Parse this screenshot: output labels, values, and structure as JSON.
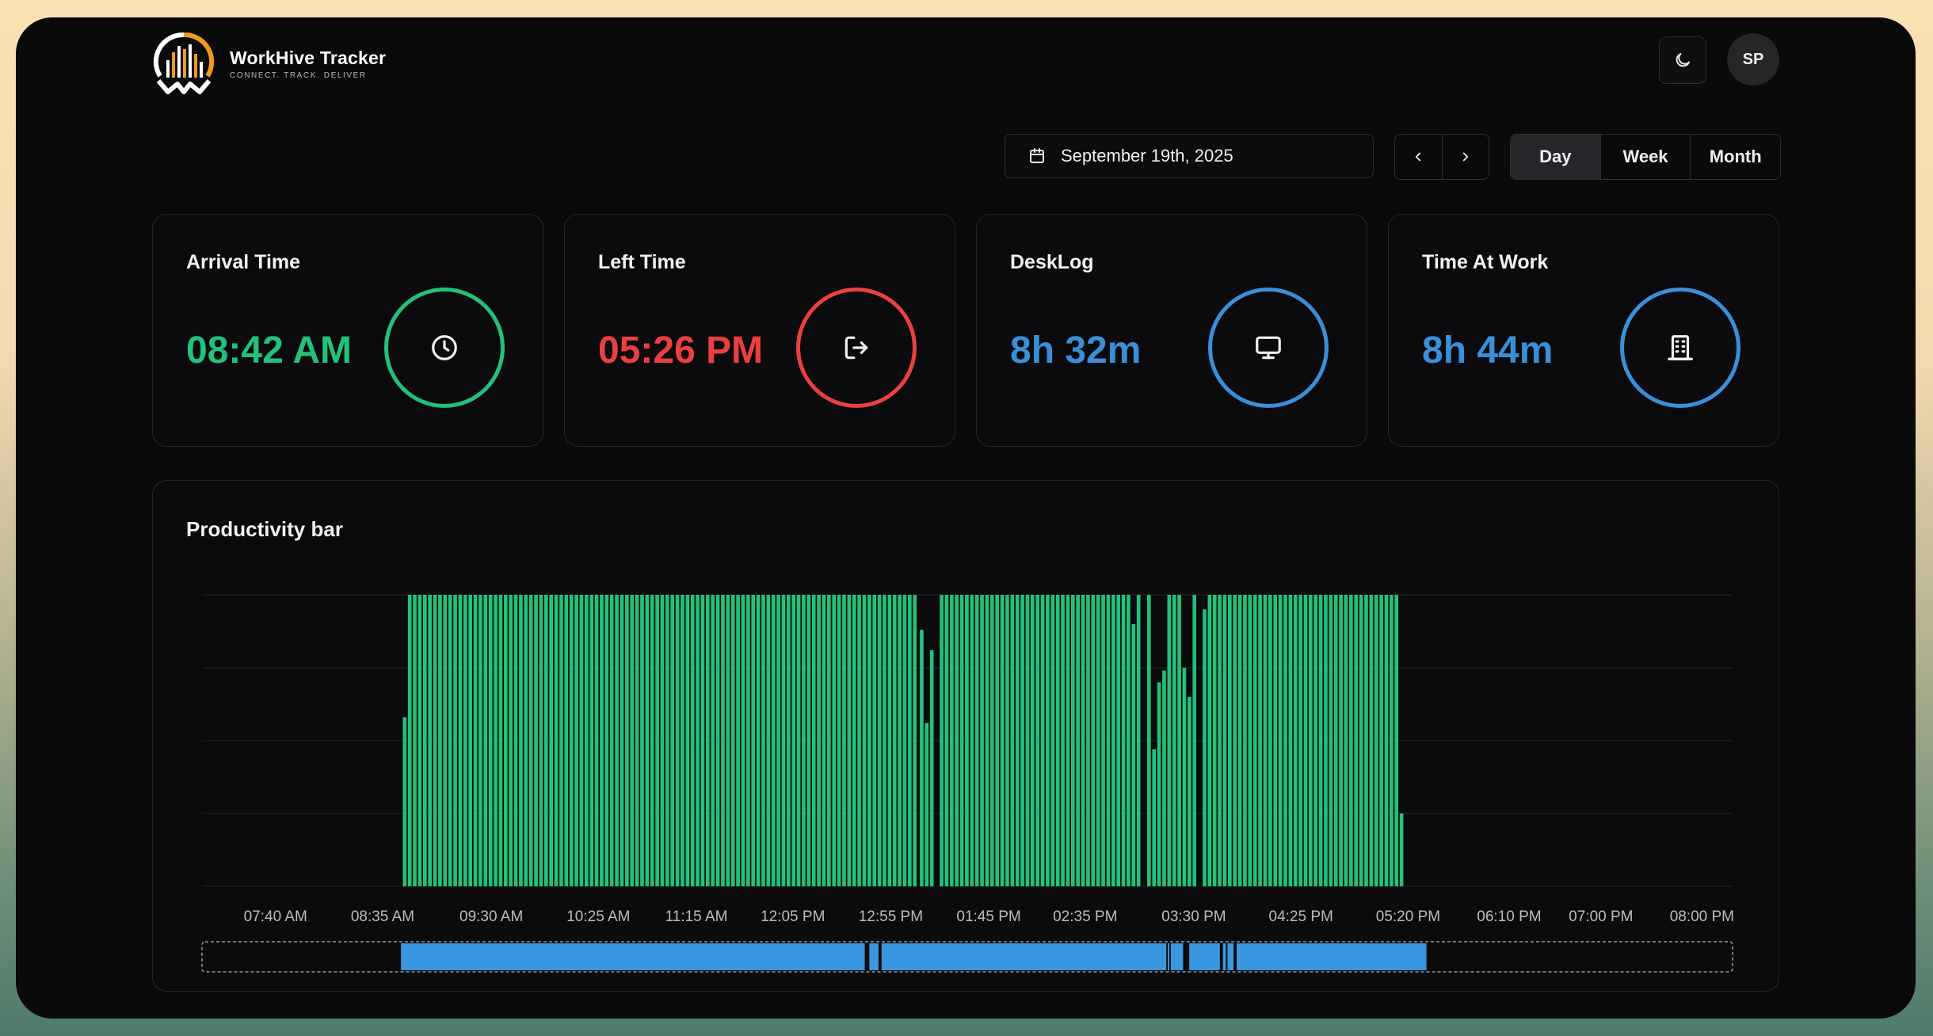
{
  "app": {
    "name": "WorkHive Tracker",
    "tagline": "CONNECT. TRACK. DELIVER",
    "user_initials": "SP",
    "theme_icon": "moon-icon"
  },
  "toolbar": {
    "date": "September 19th, 2025",
    "calendar_icon": "calendar-icon",
    "prev_icon": "chevron-left-icon",
    "next_icon": "chevron-right-icon",
    "ranges": [
      "Day",
      "Week",
      "Month"
    ],
    "active_range": "Day"
  },
  "cards": [
    {
      "title": "Arrival Time",
      "value": "08:42 AM",
      "color": "#22c27a",
      "icon": "clock-icon"
    },
    {
      "title": "Left Time",
      "value": "05:26 PM",
      "color": "#ec4040",
      "icon": "logout-icon"
    },
    {
      "title": "DeskLog",
      "value": "8h 32m",
      "color": "#3b8fd9",
      "icon": "monitor-icon"
    },
    {
      "title": "Time At Work",
      "value": "8h 44m",
      "color": "#3b8fd9",
      "icon": "building-icon"
    }
  ],
  "productivity": {
    "title": "Productivity bar",
    "bar_color": "#22c27a",
    "timeline_color": "#3b96e0"
  },
  "chart_data": {
    "type": "bar",
    "title": "Productivity bar",
    "x_tick_labels": [
      "07:40 AM",
      "08:35 AM",
      "09:30 AM",
      "10:25 AM",
      "11:15 AM",
      "12:05 PM",
      "12:55 PM",
      "01:45 PM",
      "02:35 PM",
      "03:30 PM",
      "04:25 PM",
      "05:20 PM",
      "06:10 PM",
      "07:00 PM",
      "08:00 PM"
    ],
    "x_tick_positions": [
      0.048,
      0.118,
      0.189,
      0.259,
      0.323,
      0.386,
      0.45,
      0.514,
      0.577,
      0.648,
      0.718,
      0.788,
      0.854,
      0.914,
      0.98
    ],
    "x_range": [
      0.0,
      1.0
    ],
    "ylim": [
      0,
      100
    ],
    "grid": true,
    "bar_width": 0.0024,
    "bars": [
      {
        "x": 0.1312,
        "value": 58
      },
      {
        "x": 0.1345,
        "value": 100
      },
      {
        "x": 0.1378,
        "value": 100
      },
      {
        "x": 0.1411,
        "value": 100
      },
      {
        "x": 0.1444,
        "value": 100
      },
      {
        "x": 0.1477,
        "value": 100
      },
      {
        "x": 0.151,
        "value": 100
      },
      {
        "x": 0.1543,
        "value": 100
      },
      {
        "x": 0.1576,
        "value": 100
      },
      {
        "x": 0.1609,
        "value": 100
      },
      {
        "x": 0.1642,
        "value": 100
      },
      {
        "x": 0.1675,
        "value": 100
      },
      {
        "x": 0.1708,
        "value": 100
      },
      {
        "x": 0.1741,
        "value": 100
      },
      {
        "x": 0.1774,
        "value": 100
      },
      {
        "x": 0.1807,
        "value": 100
      },
      {
        "x": 0.184,
        "value": 100
      },
      {
        "x": 0.1873,
        "value": 100
      },
      {
        "x": 0.1906,
        "value": 100
      },
      {
        "x": 0.1939,
        "value": 100
      },
      {
        "x": 0.1972,
        "value": 100
      },
      {
        "x": 0.2005,
        "value": 100
      },
      {
        "x": 0.2038,
        "value": 100
      },
      {
        "x": 0.2071,
        "value": 100
      },
      {
        "x": 0.2104,
        "value": 100
      },
      {
        "x": 0.2137,
        "value": 100
      },
      {
        "x": 0.217,
        "value": 100
      },
      {
        "x": 0.2203,
        "value": 100
      },
      {
        "x": 0.2236,
        "value": 100
      },
      {
        "x": 0.2269,
        "value": 100
      },
      {
        "x": 0.2302,
        "value": 100
      },
      {
        "x": 0.2335,
        "value": 100
      },
      {
        "x": 0.2368,
        "value": 100
      },
      {
        "x": 0.2401,
        "value": 100
      },
      {
        "x": 0.2434,
        "value": 100
      },
      {
        "x": 0.2467,
        "value": 100
      },
      {
        "x": 0.25,
        "value": 100
      },
      {
        "x": 0.2533,
        "value": 100
      },
      {
        "x": 0.2566,
        "value": 100
      },
      {
        "x": 0.2599,
        "value": 100
      },
      {
        "x": 0.2632,
        "value": 100
      },
      {
        "x": 0.2665,
        "value": 100
      },
      {
        "x": 0.2698,
        "value": 100
      },
      {
        "x": 0.2731,
        "value": 100
      },
      {
        "x": 0.2764,
        "value": 100
      },
      {
        "x": 0.2797,
        "value": 100
      },
      {
        "x": 0.283,
        "value": 100
      },
      {
        "x": 0.2863,
        "value": 100
      },
      {
        "x": 0.2896,
        "value": 100
      },
      {
        "x": 0.2929,
        "value": 100
      },
      {
        "x": 0.2962,
        "value": 100
      },
      {
        "x": 0.2995,
        "value": 100
      },
      {
        "x": 0.3028,
        "value": 100
      },
      {
        "x": 0.3061,
        "value": 100
      },
      {
        "x": 0.3094,
        "value": 100
      },
      {
        "x": 0.3127,
        "value": 100
      },
      {
        "x": 0.316,
        "value": 100
      },
      {
        "x": 0.3193,
        "value": 100
      },
      {
        "x": 0.3226,
        "value": 100
      },
      {
        "x": 0.3259,
        "value": 100
      },
      {
        "x": 0.3292,
        "value": 100
      },
      {
        "x": 0.3325,
        "value": 100
      },
      {
        "x": 0.3358,
        "value": 100
      },
      {
        "x": 0.3391,
        "value": 100
      },
      {
        "x": 0.3424,
        "value": 100
      },
      {
        "x": 0.3457,
        "value": 100
      },
      {
        "x": 0.349,
        "value": 100
      },
      {
        "x": 0.3523,
        "value": 100
      },
      {
        "x": 0.3556,
        "value": 100
      },
      {
        "x": 0.3589,
        "value": 100
      },
      {
        "x": 0.3622,
        "value": 100
      },
      {
        "x": 0.3655,
        "value": 100
      },
      {
        "x": 0.3688,
        "value": 100
      },
      {
        "x": 0.3721,
        "value": 100
      },
      {
        "x": 0.3754,
        "value": 100
      },
      {
        "x": 0.3787,
        "value": 100
      },
      {
        "x": 0.382,
        "value": 100
      },
      {
        "x": 0.3853,
        "value": 100
      },
      {
        "x": 0.3886,
        "value": 100
      },
      {
        "x": 0.3919,
        "value": 100
      },
      {
        "x": 0.3952,
        "value": 100
      },
      {
        "x": 0.3985,
        "value": 100
      },
      {
        "x": 0.4018,
        "value": 100
      },
      {
        "x": 0.4051,
        "value": 100
      },
      {
        "x": 0.4084,
        "value": 100
      },
      {
        "x": 0.4117,
        "value": 100
      },
      {
        "x": 0.415,
        "value": 100
      },
      {
        "x": 0.4183,
        "value": 100
      },
      {
        "x": 0.4216,
        "value": 100
      },
      {
        "x": 0.4249,
        "value": 100
      },
      {
        "x": 0.4282,
        "value": 100
      },
      {
        "x": 0.4315,
        "value": 100
      },
      {
        "x": 0.4348,
        "value": 100
      },
      {
        "x": 0.4381,
        "value": 100
      },
      {
        "x": 0.4414,
        "value": 100
      },
      {
        "x": 0.4447,
        "value": 100
      },
      {
        "x": 0.448,
        "value": 100
      },
      {
        "x": 0.4513,
        "value": 100
      },
      {
        "x": 0.4546,
        "value": 100
      },
      {
        "x": 0.4579,
        "value": 100
      },
      {
        "x": 0.4612,
        "value": 100
      },
      {
        "x": 0.4645,
        "value": 100
      },
      {
        "x": 0.469,
        "value": 88
      },
      {
        "x": 0.4723,
        "value": 56
      },
      {
        "x": 0.4756,
        "value": 81
      },
      {
        "x": 0.482,
        "value": 100
      },
      {
        "x": 0.4853,
        "value": 100
      },
      {
        "x": 0.4886,
        "value": 100
      },
      {
        "x": 0.4919,
        "value": 100
      },
      {
        "x": 0.4952,
        "value": 100
      },
      {
        "x": 0.4985,
        "value": 100
      },
      {
        "x": 0.5018,
        "value": 100
      },
      {
        "x": 0.5051,
        "value": 100
      },
      {
        "x": 0.5084,
        "value": 100
      },
      {
        "x": 0.5117,
        "value": 100
      },
      {
        "x": 0.515,
        "value": 100
      },
      {
        "x": 0.5183,
        "value": 100
      },
      {
        "x": 0.5216,
        "value": 100
      },
      {
        "x": 0.5249,
        "value": 100
      },
      {
        "x": 0.5282,
        "value": 100
      },
      {
        "x": 0.5315,
        "value": 100
      },
      {
        "x": 0.5348,
        "value": 100
      },
      {
        "x": 0.5381,
        "value": 100
      },
      {
        "x": 0.5414,
        "value": 100
      },
      {
        "x": 0.5447,
        "value": 100
      },
      {
        "x": 0.548,
        "value": 100
      },
      {
        "x": 0.5513,
        "value": 100
      },
      {
        "x": 0.5546,
        "value": 100
      },
      {
        "x": 0.5579,
        "value": 100
      },
      {
        "x": 0.5612,
        "value": 100
      },
      {
        "x": 0.5645,
        "value": 100
      },
      {
        "x": 0.5678,
        "value": 100
      },
      {
        "x": 0.5711,
        "value": 100
      },
      {
        "x": 0.5744,
        "value": 100
      },
      {
        "x": 0.5777,
        "value": 100
      },
      {
        "x": 0.581,
        "value": 100
      },
      {
        "x": 0.5843,
        "value": 100
      },
      {
        "x": 0.5876,
        "value": 100
      },
      {
        "x": 0.5909,
        "value": 100
      },
      {
        "x": 0.5942,
        "value": 100
      },
      {
        "x": 0.5975,
        "value": 100
      },
      {
        "x": 0.6008,
        "value": 100
      },
      {
        "x": 0.6041,
        "value": 100
      },
      {
        "x": 0.6074,
        "value": 90
      },
      {
        "x": 0.6107,
        "value": 100
      },
      {
        "x": 0.6175,
        "value": 100
      },
      {
        "x": 0.6208,
        "value": 47
      },
      {
        "x": 0.6241,
        "value": 70
      },
      {
        "x": 0.6274,
        "value": 74
      },
      {
        "x": 0.6307,
        "value": 100
      },
      {
        "x": 0.634,
        "value": 100
      },
      {
        "x": 0.6373,
        "value": 100
      },
      {
        "x": 0.6406,
        "value": 75
      },
      {
        "x": 0.6439,
        "value": 65
      },
      {
        "x": 0.6472,
        "value": 100
      },
      {
        "x": 0.6538,
        "value": 95
      },
      {
        "x": 0.6571,
        "value": 100
      },
      {
        "x": 0.6604,
        "value": 100
      },
      {
        "x": 0.6637,
        "value": 100
      },
      {
        "x": 0.667,
        "value": 100
      },
      {
        "x": 0.6703,
        "value": 100
      },
      {
        "x": 0.6736,
        "value": 100
      },
      {
        "x": 0.6769,
        "value": 100
      },
      {
        "x": 0.6802,
        "value": 100
      },
      {
        "x": 0.6835,
        "value": 100
      },
      {
        "x": 0.6868,
        "value": 100
      },
      {
        "x": 0.6901,
        "value": 100
      },
      {
        "x": 0.6934,
        "value": 100
      },
      {
        "x": 0.6967,
        "value": 100
      },
      {
        "x": 0.7,
        "value": 100
      },
      {
        "x": 0.7033,
        "value": 100
      },
      {
        "x": 0.7066,
        "value": 100
      },
      {
        "x": 0.7099,
        "value": 100
      },
      {
        "x": 0.7132,
        "value": 100
      },
      {
        "x": 0.7165,
        "value": 100
      },
      {
        "x": 0.7198,
        "value": 100
      },
      {
        "x": 0.7231,
        "value": 100
      },
      {
        "x": 0.7264,
        "value": 100
      },
      {
        "x": 0.7297,
        "value": 100
      },
      {
        "x": 0.733,
        "value": 100
      },
      {
        "x": 0.7363,
        "value": 100
      },
      {
        "x": 0.7396,
        "value": 100
      },
      {
        "x": 0.7429,
        "value": 100
      },
      {
        "x": 0.7462,
        "value": 100
      },
      {
        "x": 0.7495,
        "value": 100
      },
      {
        "x": 0.7528,
        "value": 100
      },
      {
        "x": 0.7561,
        "value": 100
      },
      {
        "x": 0.7594,
        "value": 100
      },
      {
        "x": 0.7627,
        "value": 100
      },
      {
        "x": 0.766,
        "value": 100
      },
      {
        "x": 0.7693,
        "value": 100
      },
      {
        "x": 0.7726,
        "value": 100
      },
      {
        "x": 0.7759,
        "value": 100
      },
      {
        "x": 0.7792,
        "value": 100
      },
      {
        "x": 0.7825,
        "value": 25
      }
    ],
    "timeline_segments": [
      [
        0.13,
        0.433
      ],
      [
        0.436,
        0.442
      ],
      [
        0.444,
        0.63
      ],
      [
        0.631,
        0.632
      ],
      [
        0.633,
        0.641
      ],
      [
        0.645,
        0.665
      ],
      [
        0.667,
        0.669
      ],
      [
        0.67,
        0.674
      ],
      [
        0.676,
        0.8
      ]
    ]
  }
}
